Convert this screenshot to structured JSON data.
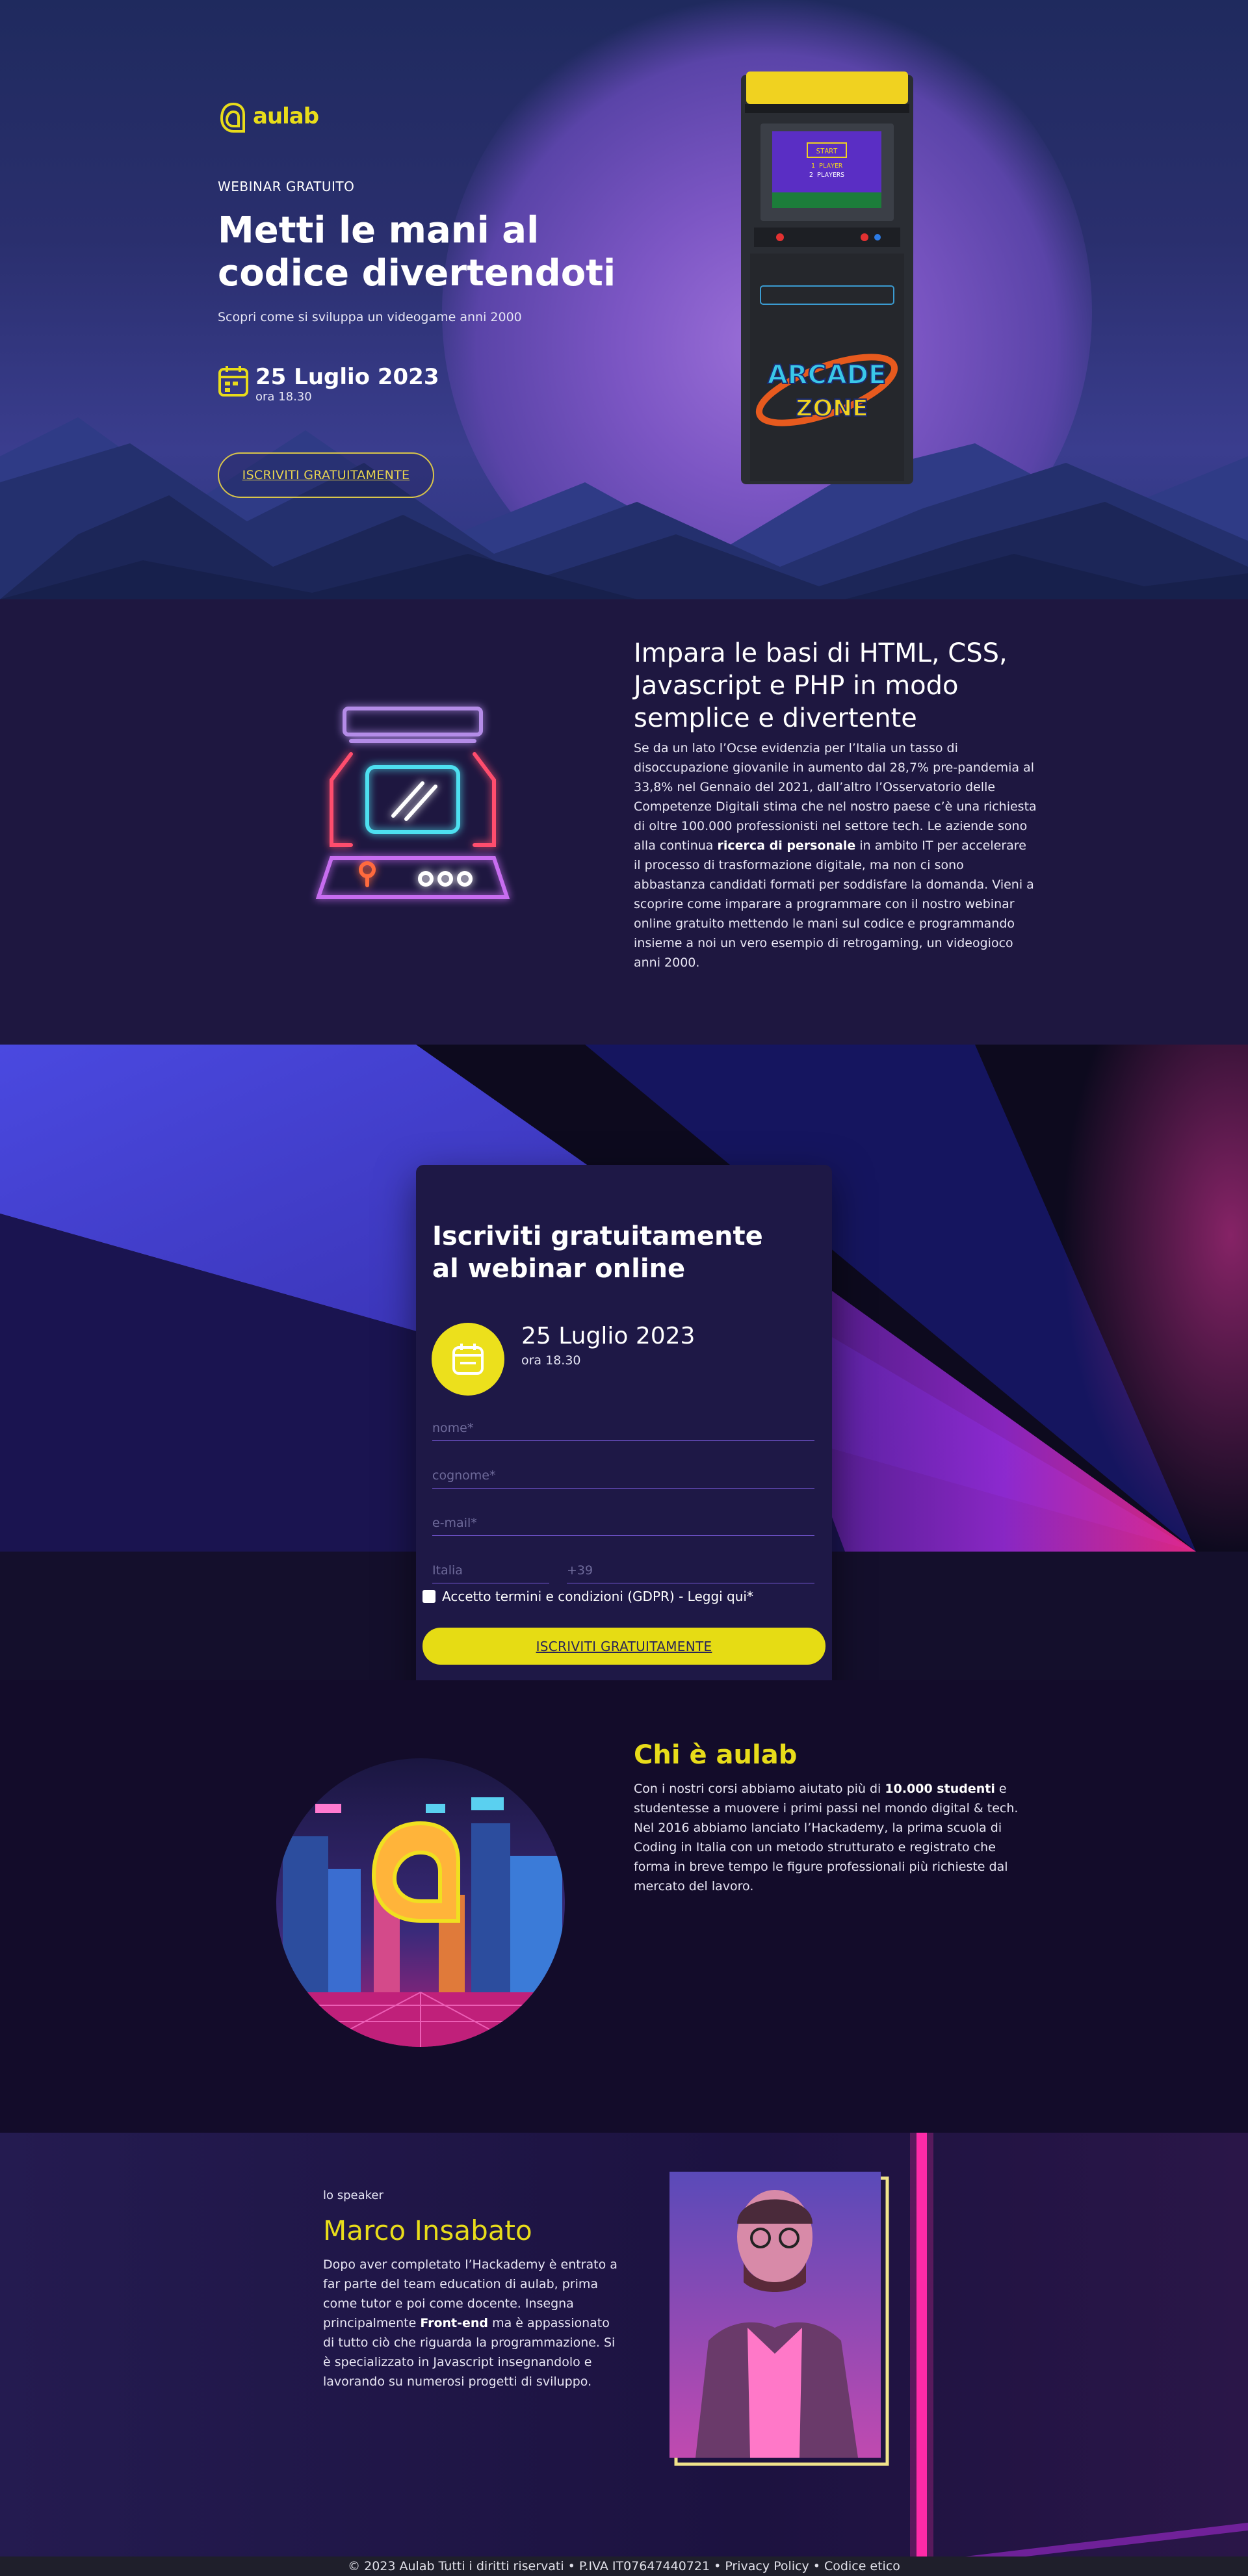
{
  "brand": {
    "name": "aulab",
    "accent": "#e8dc1a"
  },
  "hero": {
    "eyebrow": "WEBINAR GRATUITO",
    "title": "Metti le mani al codice divertendoti",
    "subtitle": "Scopri come si sviluppa un videogame anni 2000",
    "date": "25 Luglio 2023",
    "time": "ora 18.30",
    "cta": "ISCRIVITI GRATUITAMENTE",
    "arcade_screen": [
      "START",
      "1 PLAYER",
      "2 PLAYERS"
    ],
    "arcade_logo": [
      "ARCADE",
      "ZONE"
    ]
  },
  "about": {
    "title": "Impara le basi di HTML, CSS, Javascript e PHP in modo semplice e divertente",
    "text_1": "Se da un lato l’Ocse evidenzia per l’Italia un tasso di disoccupazione giovanile in aumento dal 28,7% pre-pandemia al 33,8% nel Gennaio del 2021, dall’altro l’Osservatorio delle Competenze Digitali stima che nel nostro paese c’è una richiesta di oltre 100.000 professionisti nel settore tech. Le aziende sono alla continua ",
    "text_bold": "ricerca di personale",
    "text_2": " in ambito IT per accelerare il processo di trasformazione digitale, ma non ci sono abbastanza candidati formati per soddisfare la domanda. Vieni a scoprire come imparare a programmare con il nostro webinar online gratuito mettendo le mani sul codice e programmando insieme a noi un vero esempio di retrogaming, un videogioco anni 2000."
  },
  "form": {
    "title": "Iscriviti gratuitamente al webinar online",
    "date": "25 Luglio 2023",
    "time": "ora 18.30",
    "name_placeholder": "nome*",
    "surname_placeholder": "cognome*",
    "email_placeholder": "e-mail*",
    "country_placeholder": "Italia",
    "phone_placeholder": "+39",
    "terms": "Accetto termini e condizioni (GDPR) - Leggi qui*",
    "submit": "ISCRIVITI GRATUITAMENTE"
  },
  "chi": {
    "title": "Chi è aulab",
    "text_1": "Con i nostri corsi abbiamo aiutato più di ",
    "text_bold": "10.000 studenti",
    "text_2": " e studentesse a muovere i primi passi nel mondo digital & tech. Nel 2016 abbiamo lanciato l’Hackademy, la prima scuola di Coding in Italia con un metodo strutturato e registrato che forma in breve tempo le figure professionali più richieste dal mercato del lavoro."
  },
  "speaker": {
    "label": "lo speaker",
    "name": "Marco Insabato",
    "text_1": "Dopo aver completato l’Hackademy è entrato a far parte del team education di aulab, prima come tutor e poi come docente. Insegna principalmente ",
    "text_bold": "Front-end",
    "text_2": " ma è appassionato di tutto ciò che riguarda la programmazione. Si è specializzato in Javascript insegnandolo e lavorando su numerosi progetti di sviluppo."
  },
  "footer": {
    "copy": "© 2023 Aulab Tutti i diritti riservati • P.IVA IT07647440721 •",
    "privacy": "Privacy Policy",
    "sep": "•",
    "ethics": "Codice etico"
  }
}
